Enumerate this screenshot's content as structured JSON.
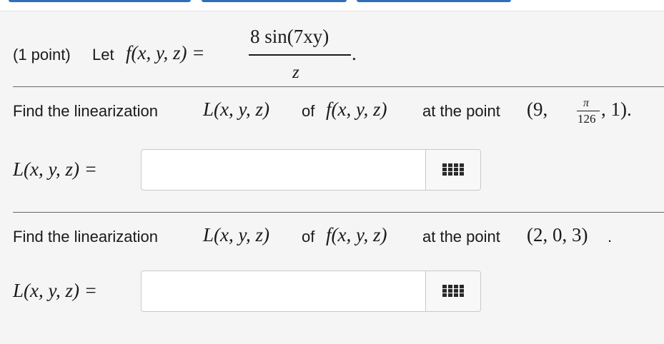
{
  "problem": {
    "points": "(1 point)",
    "let_word": "Let",
    "func_lhs": "f(x, y, z) =",
    "numerator": "8 sin(7xy)",
    "denominator": "z",
    "period": "."
  },
  "part1": {
    "prompt_start": "Find the linearization",
    "L_expr": "L(x, y, z)",
    "of_word": "of",
    "f_expr": "f(x, y, z)",
    "at_text": "at the point",
    "point_open": "(9,",
    "point_pi": "π",
    "point_den": "126",
    "point_close": ", 1).",
    "answer_label": "L(x, y, z) =",
    "answer_value": ""
  },
  "part2": {
    "prompt_start": "Find the linearization",
    "L_expr": "L(x, y, z)",
    "of_word": "of",
    "f_expr": "f(x, y, z)",
    "at_text": "at the point",
    "point": "(2, 0, 3)",
    "period": ".",
    "answer_label": "L(x, y, z) =",
    "answer_value": ""
  },
  "icons": {
    "palette": "grid-icon"
  },
  "colors": {
    "tab_accent": "#2f6fba",
    "panel_bg": "#f5f5f5"
  }
}
